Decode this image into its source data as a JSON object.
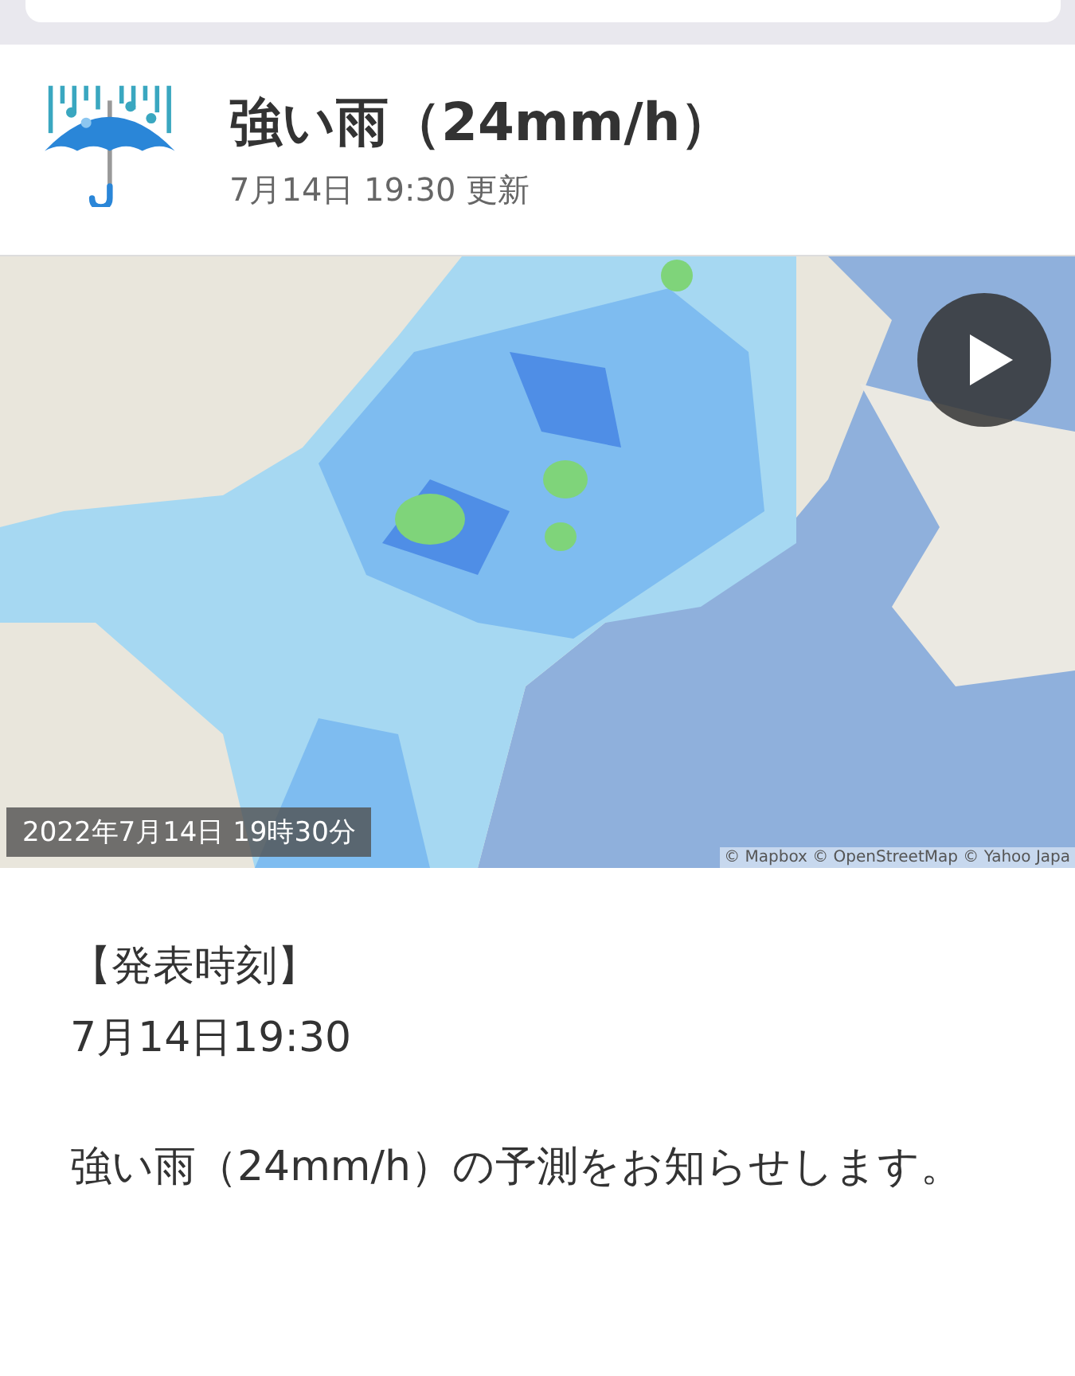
{
  "header": {
    "title": "強い雨（24mm/h）",
    "updated": "7月14日 19:30 更新"
  },
  "map": {
    "kind": "picture",
    "timestamp": "2022年7月14日 19時30分",
    "attribution": "© Mapbox © OpenStreetMap © Yahoo Japa"
  },
  "body": {
    "heading": "【発表時刻】",
    "time": "7月14日19:30",
    "message": "強い雨（24mm/h）の予測をお知らせします。"
  }
}
